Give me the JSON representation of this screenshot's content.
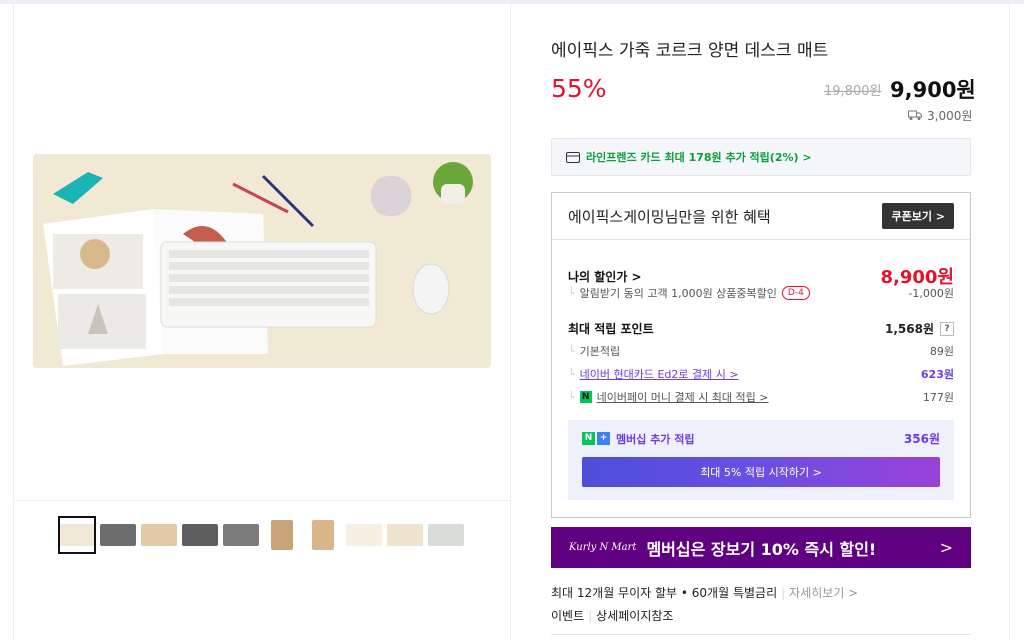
{
  "product": {
    "title": "에이픽스 가죽 코르크 양면 데스크 매트",
    "discount_rate": "55%",
    "original_price": "19,800원",
    "sale_price": "9,900원",
    "shipping_fee": "3,000원"
  },
  "card_promo": "라인프렌즈 카드 최대 178원 추가 적립(2%) >",
  "benefit": {
    "heading": "에이픽스게이밍님만을 위한 혜택",
    "coupon_button": "쿠폰보기 >",
    "my_price_label": "나의 할인가 >",
    "my_price": "8,900원",
    "notify_discount_label": "알림받기 동의 고객 1,000원 상품중복할인",
    "notify_dday": "D-4",
    "notify_discount_value": "-1,000원",
    "max_points_label": "최대 적립 포인트",
    "max_points": "1,568원",
    "help_mark": "?",
    "basic_points_label": "기본적립",
    "basic_points": "89원",
    "naver_card_label": "네이버 현대카드 Ed2로 결제 시 >",
    "naver_card_points": "623원",
    "npay_label": "네이버페이 머니 결제 시 최대 적립 >",
    "npay_points": "177원",
    "membership_label": "멤버십 추가 적립",
    "membership_points": "356원",
    "start_button": "최대 5% 적립 시작하기 >"
  },
  "banner": {
    "brand": "Kurly N Mart",
    "message": "멤버십은 장보기 10% 즉시 할인!",
    "arrow": ">"
  },
  "installment": {
    "text": "최대 12개월 무이자 할부 • 60개월 특별금리",
    "link": "자세히보기 >"
  },
  "links": [
    "이벤트",
    "상세페이지참조"
  ],
  "thumbnails_count": 10,
  "colors": {
    "discount": "#e3132c",
    "naver_green": "#03c75a",
    "kurly_purple": "#5f0080",
    "accent_purple": "#6d3de0"
  }
}
